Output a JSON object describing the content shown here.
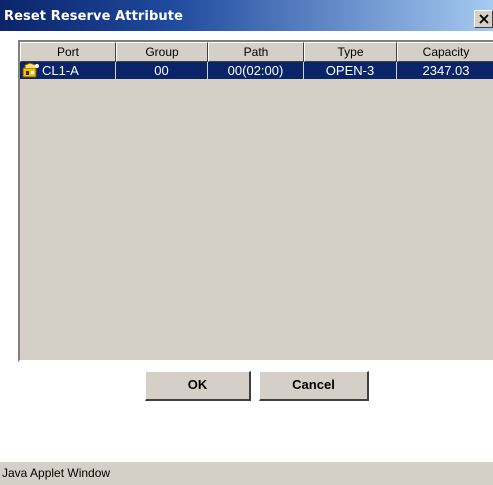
{
  "window": {
    "title": "Reset Reserve Attribute",
    "close_icon": "close-icon"
  },
  "table": {
    "columns": [
      "Port",
      "Group",
      "Path",
      "Type",
      "Capacity"
    ],
    "rows": [
      {
        "icon": "port-host-icon",
        "port": "CL1-A",
        "group": "00",
        "path": "00(02:00)",
        "type": "OPEN-3",
        "capacity": "2347.03",
        "selected": true
      }
    ]
  },
  "buttons": {
    "ok": "OK",
    "cancel": "Cancel"
  },
  "status": "Java Applet Window",
  "colors": {
    "selection": "#0a246a",
    "face": "#d4d0c8",
    "title_start": "#0b246a",
    "title_end": "#a6caf0"
  }
}
